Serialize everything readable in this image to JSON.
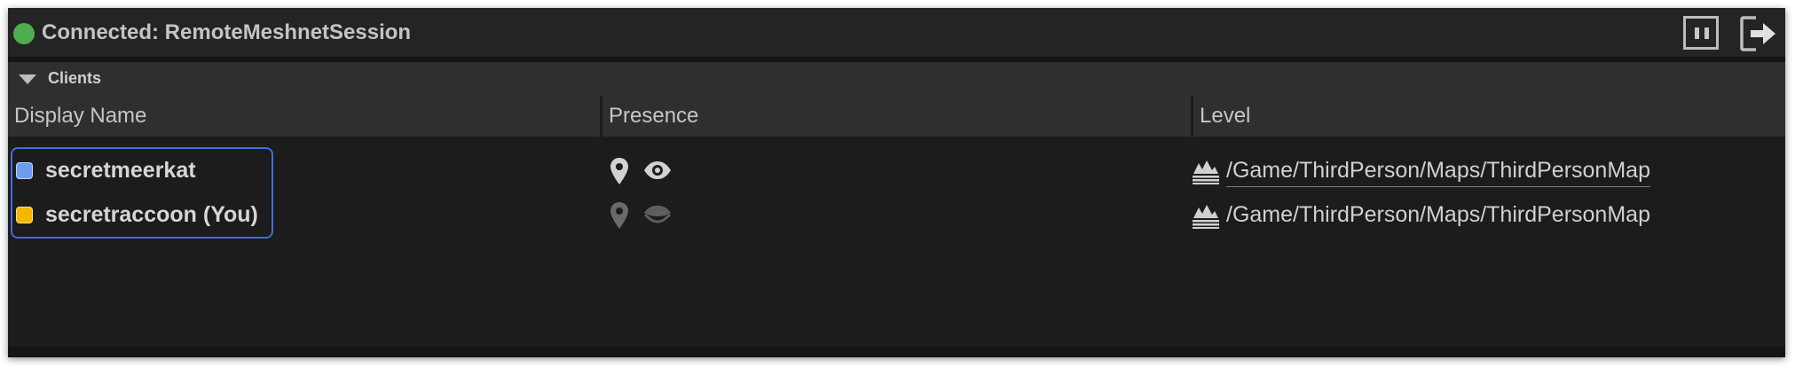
{
  "window": {
    "title": "Connected: RemoteMeshnetSession",
    "status_color": "#4cae4c"
  },
  "toolbar": {
    "pause_icon": "pause-icon",
    "leave_icon": "leave-session-icon"
  },
  "section": {
    "label": "Clients",
    "expanded": true
  },
  "columns": [
    {
      "label": "Display Name"
    },
    {
      "label": "Presence"
    },
    {
      "label": "Level"
    }
  ],
  "clients": [
    {
      "display_name": "secretmeerkat",
      "color": "#6f9cf3",
      "presence_icons": [
        "location-pin-icon",
        "eye-icon"
      ],
      "presence_active": true,
      "level": "/Game/ThirdPerson/Maps/ThirdPersonMap"
    },
    {
      "display_name": "secretraccoon (You)",
      "color": "#f5b800",
      "presence_icons": [
        "location-pin-icon",
        "eye-closed-icon"
      ],
      "presence_active": false,
      "level": "/Game/ThirdPerson/Maps/ThirdPersonMap"
    }
  ]
}
